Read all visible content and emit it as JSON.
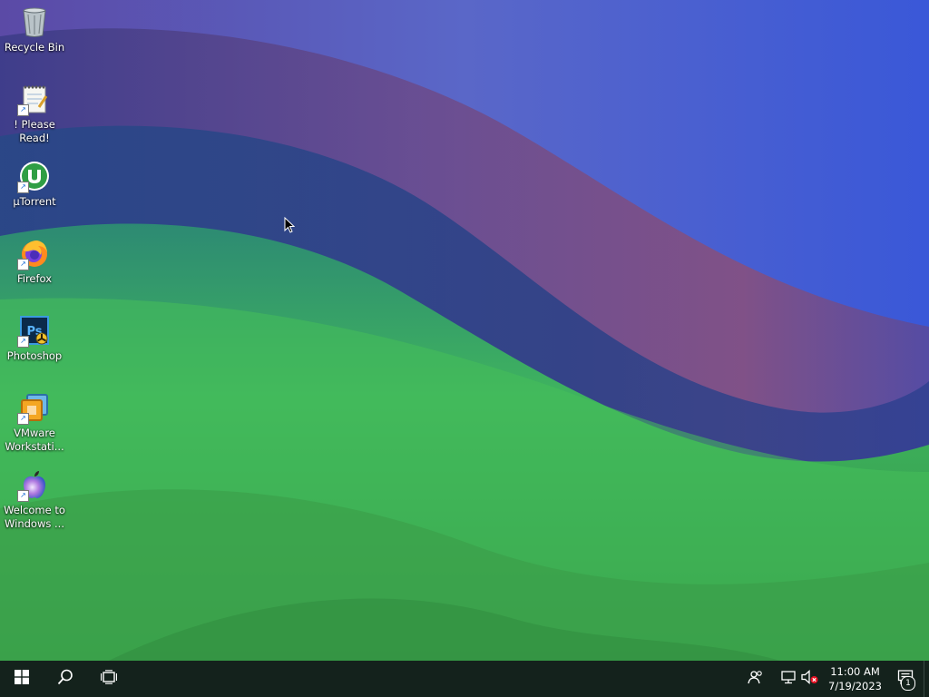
{
  "desktop": {
    "icons": [
      {
        "label": "Recycle Bin",
        "icon": "recycle-bin-icon"
      },
      {
        "label": "! Please Read!",
        "icon": "notepad-icon"
      },
      {
        "label": "µTorrent",
        "icon": "utorrent-icon"
      },
      {
        "label": "Firefox",
        "icon": "firefox-icon"
      },
      {
        "label": "Photoshop",
        "icon": "photoshop-icon"
      },
      {
        "label": "VMware\nWorkstati...",
        "icon": "vmware-icon"
      },
      {
        "label": "Welcome to\nWindows ...",
        "icon": "apple-logo-icon"
      }
    ]
  },
  "taskbar": {
    "start_icon": "windows-logo-icon",
    "search_icon": "search-icon",
    "task_view_icon": "task-view-icon",
    "tray": {
      "people_icon": "people-icon",
      "network_icon": "network-icon",
      "volume_icon": "volume-muted-icon",
      "time": "11:00 AM",
      "date": "7/19/2023",
      "notification_icon": "action-center-icon",
      "notification_count": "1"
    }
  },
  "colors": {
    "taskbar_bg": "#14221c",
    "label_text": "#ffffff"
  }
}
